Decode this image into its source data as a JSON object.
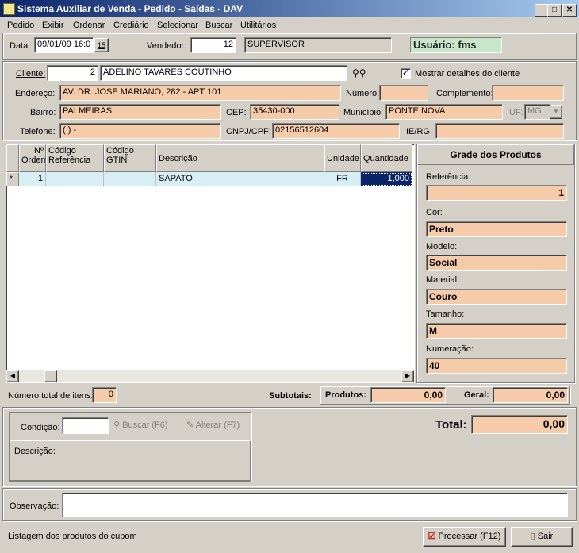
{
  "window": {
    "title": "Sistema Auxiliar de Venda - Pedido - Saídas - DAV"
  },
  "menu": [
    "Pedido",
    "Exibir",
    "Ordenar",
    "Crediário",
    "Selecionar",
    "Buscar",
    "Utilitários"
  ],
  "header": {
    "data_label": "Data:",
    "data_value": "09/01/09 16:0",
    "calendar_day": "15",
    "vendedor_label": "Vendedor:",
    "vendedor_code": "12",
    "vendedor_name": "SUPERVISOR",
    "usuario": "Usuário: fms"
  },
  "client": {
    "cliente_label": "Cliente:",
    "cliente_code": "2",
    "cliente_name": "ADELINO TAVARES COUTINHO",
    "mostrar_label": "Mostrar detalhes do cliente",
    "endereco_label": "Endereço:",
    "endereco": "AV. DR. JOSE MARIANO, 282 - APT 101",
    "numero_label": "Número:",
    "numero": "",
    "complemento_label": "Complemento:",
    "complemento": "",
    "bairro_label": "Bairro:",
    "bairro": "PALMEIRAS",
    "cep_label": "CEP:",
    "cep": "35430-000",
    "municipio_label": "Município:",
    "municipio": "PONTE NOVA",
    "uf_label": "UF:",
    "uf": "MG",
    "telefone_label": "Telefone:",
    "telefone": "(  )    -",
    "cnpj_label": "CNPJ/CPF:",
    "cnpj": "02156512604",
    "ie_label": "IE/RG:",
    "ie": ""
  },
  "grid": {
    "headers": {
      "ordem": "Nº Ordem",
      "cod_ref": "Código Referência",
      "cod_gtin": "Código GTIN",
      "descricao": "Descrição",
      "unidade": "Unidade",
      "quantidade": "Quantidade"
    },
    "rows": [
      {
        "marker": "*",
        "ordem": "1",
        "cod_ref": "",
        "cod_gtin": "",
        "descricao": "SAPATO",
        "unidade": "FR",
        "quantidade": "1,000"
      }
    ]
  },
  "grade": {
    "title": "Grade dos Produtos",
    "referencia_label": "Referência:",
    "referencia": "1",
    "cor_label": "Cor:",
    "cor": "Preto",
    "modelo_label": "Modelo:",
    "modelo": "Social",
    "material_label": "Material:",
    "material": "Couro",
    "tamanho_label": "Tamanho:",
    "tamanho": "M",
    "numeracao_label": "Numeração:",
    "numeracao": "40"
  },
  "totals": {
    "num_itens_label": "Número total de itens:",
    "num_itens": "0",
    "subtotais_label": "Subtotais:",
    "produtos_label": "Produtos:",
    "produtos": "0,00",
    "geral_label": "Geral:",
    "geral": "0,00",
    "total_label": "Total:",
    "total": "0,00"
  },
  "condicao": {
    "label": "Condição:",
    "value": "",
    "buscar": "Buscar (F6)",
    "alterar": "Alterar (F7)",
    "descricao_label": "Descrição:"
  },
  "observacao": {
    "label": "Observação:",
    "value": ""
  },
  "status": {
    "text": "Listagem dos produtos do cupom"
  },
  "buttons": {
    "processar": "Processar (F12)",
    "sair": "Sair"
  }
}
